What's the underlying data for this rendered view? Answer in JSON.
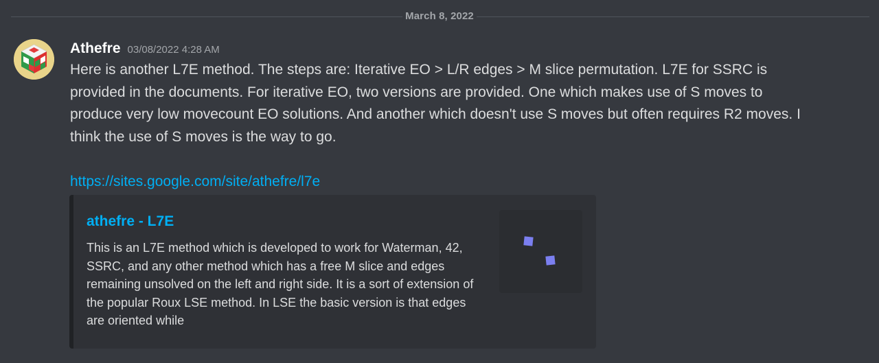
{
  "date_divider": {
    "label": "March 8, 2022"
  },
  "message": {
    "author": "Athefre",
    "timestamp": "03/08/2022 4:28 AM",
    "avatar_icon": "rubiks-cube-icon",
    "text": "Here is another L7E method. The steps are: Iterative EO > L/R edges > M slice permutation. L7E for SSRC is provided in the documents. For iterative EO, two versions are provided. One which makes use of S moves to produce very low movecount EO solutions. And another which doesn't use S moves but often requires R2 moves. I think the use of S moves is the way to go.",
    "link": "https://sites.google.com/site/athefre/l7e"
  },
  "embed": {
    "title": "athefre - L7E",
    "description": "This is an L7E method which is developed to work for Waterman, 42, SSRC, and any other method which has a free M slice and edges remaining unsolved on the left and right side. It is a sort of extension of the popular Roux LSE method. In LSE the basic version is that edges are oriented while",
    "thumbnail_icon": "loading-dots-icon"
  },
  "colors": {
    "background": "#36393f",
    "link": "#00aff4",
    "text": "#dcddde",
    "muted": "#a3a6aa",
    "embed_bg": "#2f3136",
    "accent_dots": "#7b7ff0"
  }
}
